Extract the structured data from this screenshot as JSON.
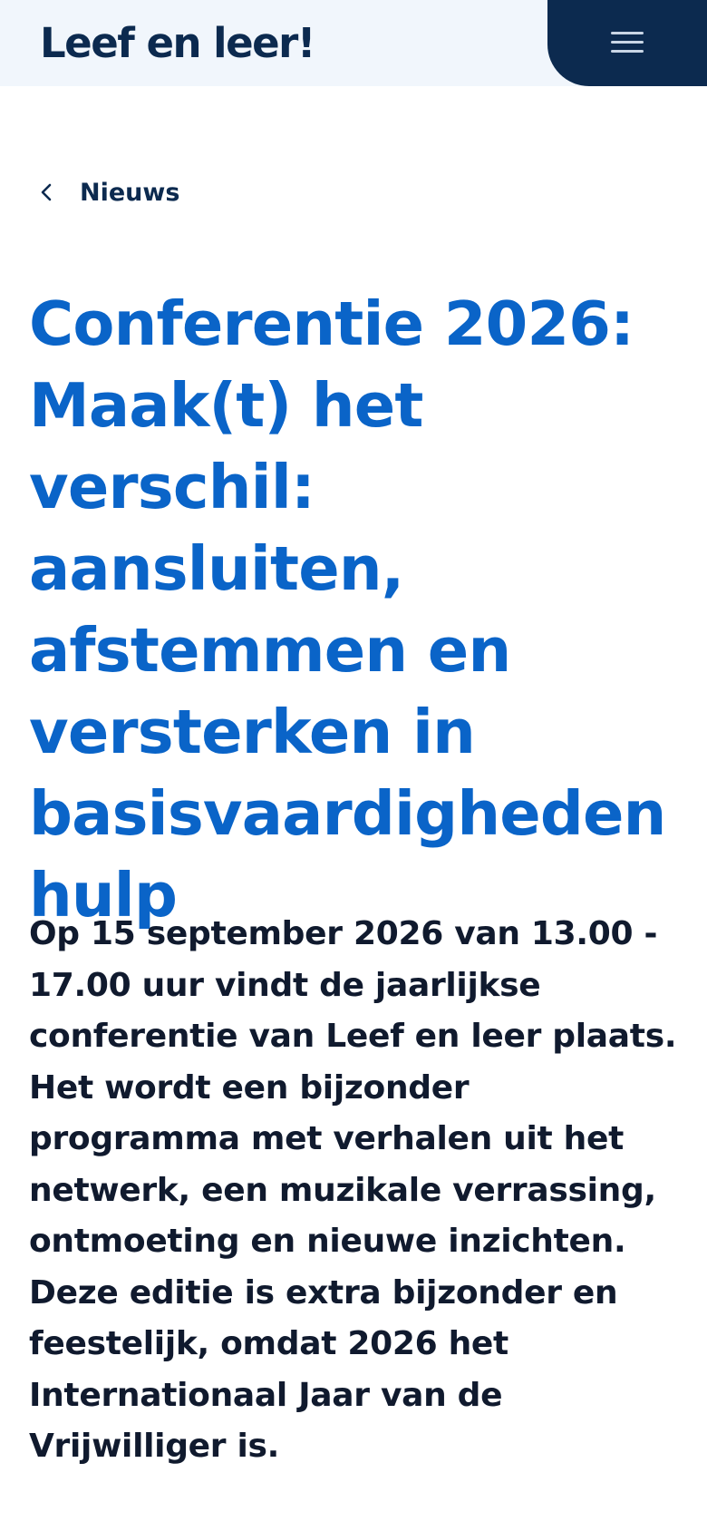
{
  "header": {
    "logo_text": "Leef en leer!",
    "menu_icon": "hamburger-menu-icon"
  },
  "breadcrumb": {
    "back_icon": "chevron-left-icon",
    "label": "Nieuws"
  },
  "article": {
    "title": "Conferentie 2026: Maak(t) het verschil: aansluiten, afstemmen en versterken in basisvaardigheden hulp",
    "intro": "Op 15 september 2026 van 13.00 - 17.00 uur vindt de jaarlijkse conferentie van Leef en leer plaats. Het wordt een bijzonder programma met verhalen uit het netwerk, een muzikale verrassing, ontmoeting en nieuwe inzichten. Deze editie is extra bijzonder en feestelijk, omdat 2026 het Internationaal Jaar van de Vrijwilliger is."
  },
  "colors": {
    "header_bg": "#f1f6fc",
    "navy": "#0c2a4f",
    "title_blue": "#0a64c8",
    "body_text": "#101a2e"
  }
}
